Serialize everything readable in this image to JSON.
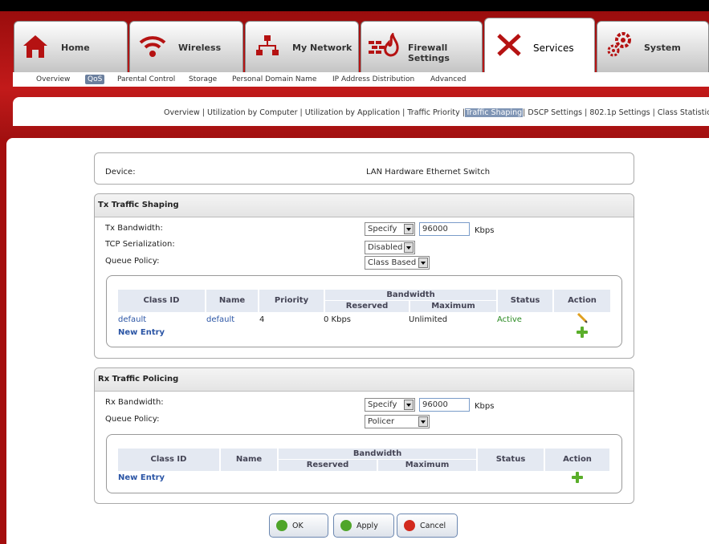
{
  "tabs": [
    {
      "label": "Home",
      "icon": "home-icon"
    },
    {
      "label": "Wireless",
      "icon": "wireless-icon"
    },
    {
      "label": "My Network",
      "icon": "network-icon"
    },
    {
      "label": "Firewall Settings",
      "icon": "firewall-icon"
    },
    {
      "label": "Services",
      "icon": "services-icon",
      "active": true
    },
    {
      "label": "System",
      "icon": "system-icon"
    }
  ],
  "subnav": [
    "Overview",
    "QoS",
    "Parental Control",
    "Storage",
    "Personal Domain Name",
    "IP Address Distribution",
    "Advanced"
  ],
  "subnav_selected": "QoS",
  "qos_links": [
    "Overview",
    "Utilization by Computer",
    "Utilization by Application",
    "Traffic Priority",
    "Traffic Shaping",
    "DSCP Settings",
    "802.1p Settings",
    "Class Statistics"
  ],
  "qos_selected": "Traffic Shaping",
  "device": {
    "label": "Device:",
    "value": "LAN Hardware Ethernet Switch"
  },
  "tx": {
    "title": "Tx Traffic Shaping",
    "bandwidth_label": "Tx Bandwidth:",
    "bandwidth_mode": "Specify",
    "bandwidth_value": "96000",
    "unit": "Kbps",
    "tcp_label": "TCP Serialization:",
    "tcp_value": "Disabled",
    "queue_label": "Queue Policy:",
    "queue_value": "Class Based",
    "table": {
      "headers": {
        "class_id": "Class ID",
        "name": "Name",
        "priority": "Priority",
        "bandwidth": "Bandwidth",
        "reserved": "Reserved",
        "maximum": "Maximum",
        "status": "Status",
        "action": "Action"
      },
      "rows": [
        {
          "class_id": "default",
          "name": "default",
          "priority": "4",
          "reserved": "0 Kbps",
          "maximum": "Unlimited",
          "status": "Active"
        }
      ],
      "new_entry": "New Entry"
    }
  },
  "rx": {
    "title": "Rx Traffic Policing",
    "bandwidth_label": "Rx Bandwidth:",
    "bandwidth_mode": "Specify",
    "bandwidth_value": "96000",
    "unit": "Kbps",
    "queue_label": "Queue Policy:",
    "queue_value": "Policer",
    "table": {
      "headers": {
        "class_id": "Class ID",
        "name": "Name",
        "bandwidth": "Bandwidth",
        "reserved": "Reserved",
        "maximum": "Maximum",
        "status": "Status",
        "action": "Action"
      },
      "new_entry": "New Entry"
    }
  },
  "buttons": {
    "ok": "OK",
    "apply": "Apply",
    "cancel": "Cancel"
  }
}
